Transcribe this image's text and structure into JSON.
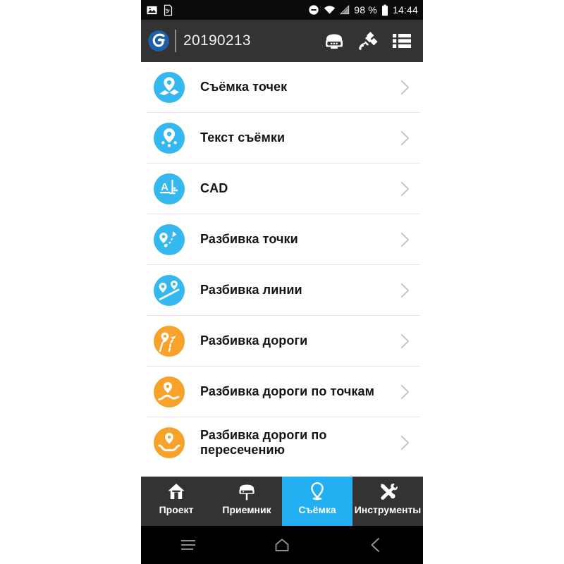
{
  "status_bar": {
    "left_icons": [
      "image-icon",
      "nfc-tag-icon"
    ],
    "dnd_icon": "do-not-disturb-icon",
    "wifi_icon": "wifi-icon",
    "signal_icon": "cell-signal-icon",
    "battery_percent": "98 %",
    "battery_icon": "battery-full-icon",
    "time": "14:44"
  },
  "app_bar": {
    "logo": "app-logo-g",
    "title": "20190213",
    "actions": [
      {
        "name": "gnss-receiver-icon",
        "label": "Приемник"
      },
      {
        "name": "satellite-icon",
        "label": "Спутники"
      },
      {
        "name": "list-menu-icon",
        "label": "Меню"
      }
    ]
  },
  "colors": {
    "accent_blue": "#35b8f0",
    "accent_orange": "#f9a22b",
    "active_tab_blue": "#22b0f2",
    "appbar_dark": "#333333",
    "status_dark": "#0b0b0b",
    "logo_blue": "#1b5fa8"
  },
  "list": {
    "items": [
      {
        "label": "Съёмка точек",
        "icon": "map-pin-survey-icon",
        "color": "#35b8f0"
      },
      {
        "label": "Текст съёмки",
        "icon": "pin-dots-icon",
        "color": "#35b8f0"
      },
      {
        "label": "CAD",
        "icon": "cad-icon",
        "color": "#35b8f0"
      },
      {
        "label": "Разбивка точки",
        "icon": "stakeout-point-icon",
        "color": "#35b8f0"
      },
      {
        "label": "Разбивка линии",
        "icon": "stakeout-line-icon",
        "color": "#35b8f0"
      },
      {
        "label": "Разбивка дороги",
        "icon": "stakeout-road-icon",
        "color": "#f9a22b"
      },
      {
        "label": "Разбивка дороги по точкам",
        "icon": "stakeout-road-points-icon",
        "color": "#f9a22b"
      },
      {
        "label": "Разбивка дороги по пересечению",
        "icon": "stakeout-road-cross-icon",
        "color": "#f9a22b"
      }
    ],
    "chevron_icon": "chevron-right-icon"
  },
  "bottom_tabs": {
    "items": [
      {
        "label": "Проект",
        "icon": "home-icon",
        "active": false
      },
      {
        "label": "Приемник",
        "icon": "receiver-icon",
        "active": false
      },
      {
        "label": "Съёмка",
        "icon": "pin-icon",
        "active": true
      },
      {
        "label": "Инструменты",
        "icon": "tools-icon",
        "active": false
      }
    ]
  },
  "android_nav": {
    "items": [
      {
        "name": "recents-button",
        "icon": "recents-icon"
      },
      {
        "name": "home-button",
        "icon": "home-outline-icon"
      },
      {
        "name": "back-button",
        "icon": "back-chevron-icon"
      }
    ]
  }
}
